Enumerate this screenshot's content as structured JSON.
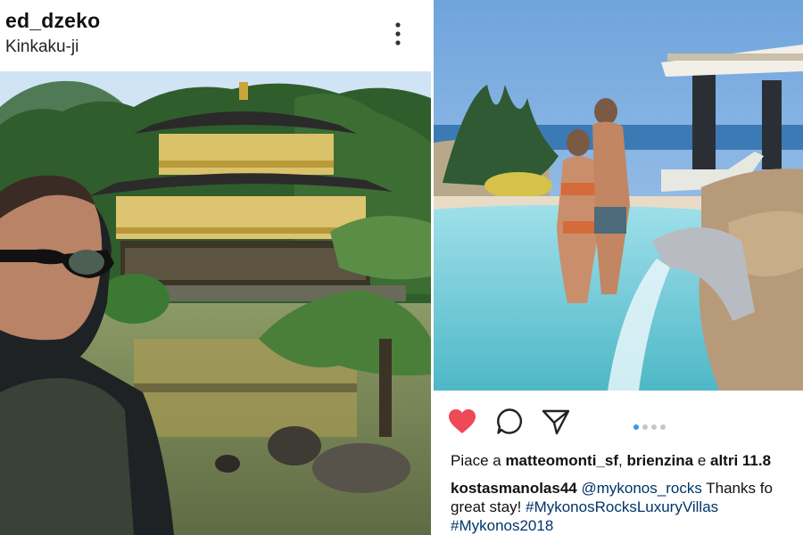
{
  "left_post": {
    "username": "ed_dzeko",
    "location": "Kinkaku-ji",
    "more_icon": "more-vertical-icon"
  },
  "right_post": {
    "likes": {
      "prefix": "Piace a ",
      "user1": "matteomonti_sf",
      "sep": ", ",
      "user2": "brienzina",
      "joiner": " e ",
      "others": "altri 11.8"
    },
    "caption": {
      "author": "kostasmanolas44",
      "mention": "@mykonos_rocks",
      "text": " Thanks fo",
      "line2": "great stay! ",
      "tag1": "#MykonosRocksLuxuryVillas",
      "tag2": "#Mykonos2018"
    },
    "icons": [
      "heart-icon",
      "comment-icon",
      "share-icon"
    ],
    "carousel": {
      "count": 4,
      "active": 1
    },
    "colors": {
      "like": "#ed4956",
      "dot_active": "#3897f0",
      "dot": "#c7c7c7"
    }
  }
}
